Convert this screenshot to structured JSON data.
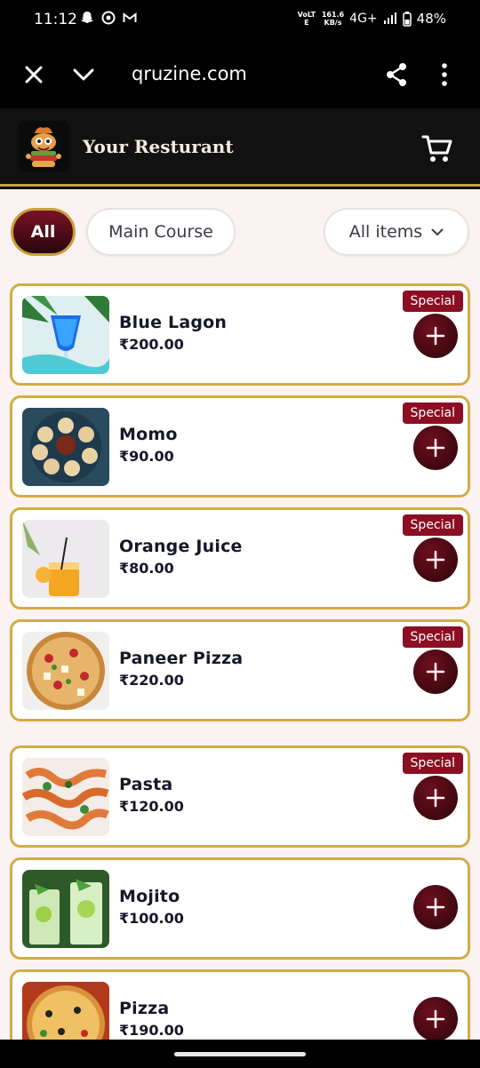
{
  "status_bar": {
    "time": "11:12",
    "left_icons": [
      "snapchat-icon",
      "instagram-icon",
      "gmail-icon"
    ],
    "volte": "VoLTE",
    "net_speed_value": "161.6",
    "net_speed_unit": "KB/s",
    "network": "4G+",
    "battery": "48%"
  },
  "browser": {
    "url": "qruzine.com"
  },
  "header": {
    "restaurant_name": "Your Resturant"
  },
  "filters": {
    "all_label": "All",
    "main_course_label": "Main Course",
    "dropdown_label": "All items"
  },
  "menu_items": [
    {
      "name": "Blue Lagon",
      "price": "₹200.00",
      "badge": "Special"
    },
    {
      "name": "Momo",
      "price": "₹90.00",
      "badge": "Special"
    },
    {
      "name": "Orange Juice",
      "price": "₹80.00",
      "badge": "Special"
    },
    {
      "name": "Paneer Pizza",
      "price": "₹220.00",
      "badge": "Special"
    },
    {
      "name": "Pasta",
      "price": "₹120.00",
      "badge": "Special"
    },
    {
      "name": "Mojito",
      "price": "₹100.00",
      "badge": ""
    },
    {
      "name": "Pizza",
      "price": "₹190.00",
      "badge": ""
    }
  ],
  "colors": {
    "accent_gold": "#d3ac45",
    "maroon": "#8b0f22",
    "background": "#fbf3f1"
  }
}
